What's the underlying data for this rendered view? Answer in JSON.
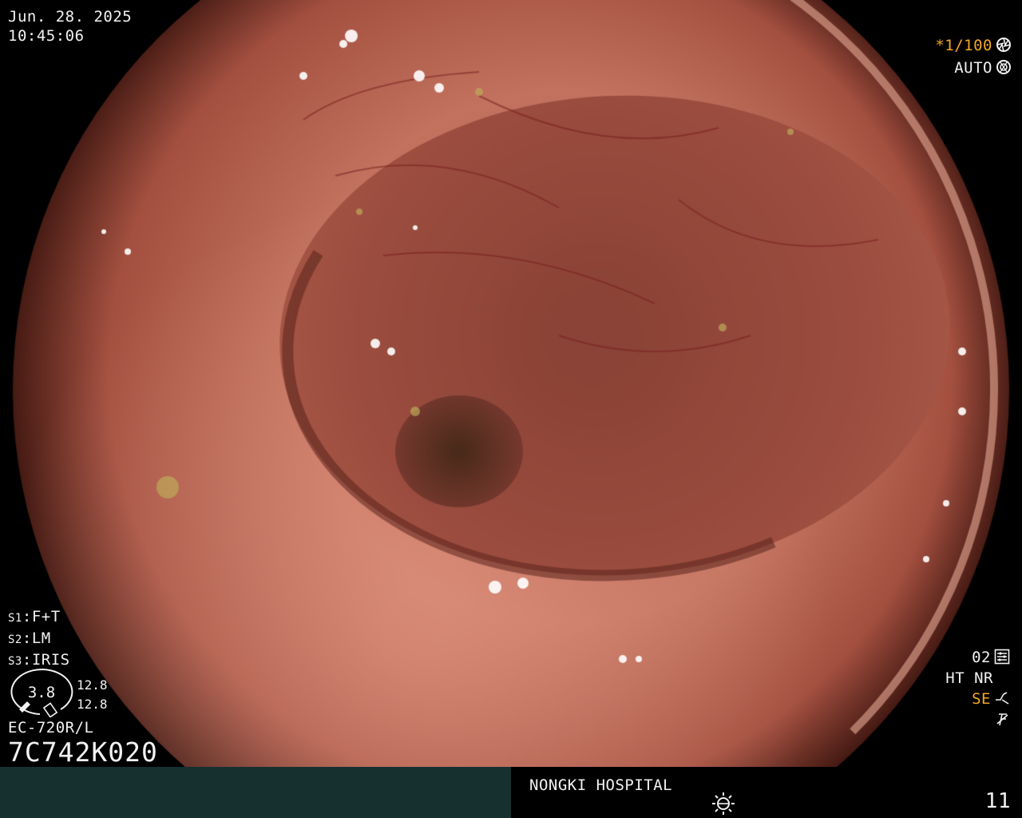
{
  "datetime": {
    "date": "Jun. 28. 2025",
    "time": "10:45:06"
  },
  "exposure": {
    "shutter": "*1/100",
    "shutter_icon": "aperture-icon",
    "mode": "AUTO",
    "mode_icon": "iris-icon",
    "shutter_color": "#f5a623"
  },
  "settings": [
    {
      "key": "S1",
      "value": "F+T"
    },
    {
      "key": "S2",
      "value": "LM"
    },
    {
      "key": "S3",
      "value": "IRIS"
    }
  ],
  "bending_gauge": {
    "value": "3.8",
    "up": "12.8",
    "down": "12.8"
  },
  "scope": {
    "model": "EC-720R/L",
    "serial": "7C742K020"
  },
  "right_panel": {
    "structure": "02",
    "structure_icon": "enhancement-icon",
    "modes": "HT NR",
    "se": "SE",
    "se_icon": "sharpness-icon",
    "freeze_icon": "freeze-off-icon",
    "se_color": "#f5a623"
  },
  "footer": {
    "hospital": "NONGKI HOSPITAL",
    "light_icon": "light-source-icon",
    "counter": "11",
    "left_panel_color": "#163030"
  },
  "image": {
    "subject": "colon-lumen-icon",
    "mucosa_color": "#b0584a",
    "lumen_color": "#7a3a30"
  }
}
